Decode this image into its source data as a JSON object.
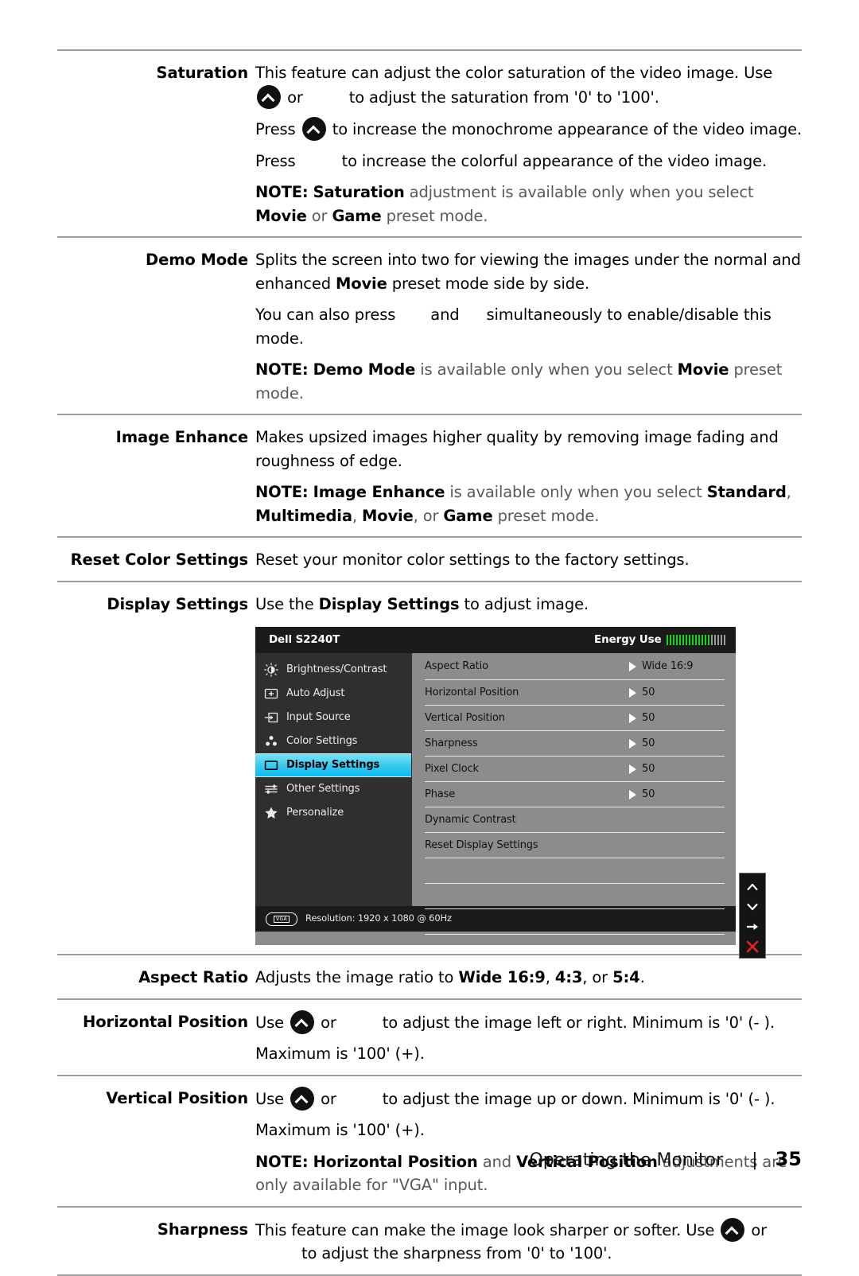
{
  "document": {
    "footer": {
      "section_title": "Operating the Monitor",
      "separator": "|",
      "page_number": "35"
    }
  },
  "rows": [
    {
      "label": "Saturation",
      "paragraphs": [
        "This feature can adjust the color saturation of the video image. Use",
        "or",
        "to adjust the saturation from '0' to '100'.",
        "Press",
        "to increase the monochrome appearance of the video image.",
        "Press",
        "to increase the colorful appearance of the video image."
      ],
      "note": {
        "prefix": "NOTE:",
        "term1": "Saturation",
        "mid1": " adjustment is available only when you select ",
        "term2": "Movie",
        "mid2": " or ",
        "term3": "Game",
        "suffix": " preset mode."
      }
    },
    {
      "label": "Demo Mode",
      "paragraphs": [
        "Splits the screen into two for viewing the images under the normal and enhanced",
        "Movie",
        "preset mode side by side.",
        "You can also press",
        "and",
        "simultaneously to enable/disable this mode."
      ],
      "note": {
        "prefix": "NOTE:",
        "term1": "Demo Mode",
        "mid1": " is available only when you select ",
        "term2": "Movie",
        "suffix": " preset mode."
      }
    },
    {
      "label": "Image Enhance",
      "paragraphs": [
        "Makes upsized images higher quality by removing image fading and roughness of edge."
      ],
      "note": {
        "prefix": "NOTE:",
        "term1": "Image Enhance",
        "mid1": " is available only when you select ",
        "term2": "Standard",
        "mid2": ", ",
        "term3": "Multimedia",
        "mid3": ", ",
        "term4": "Movie",
        "mid4": ", or ",
        "term5": "Game",
        "suffix": " preset mode."
      }
    },
    {
      "label": "Reset Color Settings",
      "paragraphs": [
        "Reset your monitor color settings to the factory settings."
      ]
    },
    {
      "label": "Display Settings",
      "paragraphs": [
        "Use the",
        "Display Settings",
        "to adjust image."
      ]
    },
    {
      "label": "Aspect Ratio",
      "paragraphs": [
        "Adjusts the image ratio to",
        "Wide 16:9",
        ",",
        "4:3",
        ", or",
        "5:4",
        "."
      ]
    },
    {
      "label": "Horizontal Position",
      "paragraphs": [
        "Use",
        "or",
        "to adjust the image left or right. Minimum is '0' (- ).",
        "Maximum is '100' (+)."
      ]
    },
    {
      "label": "Vertical Position",
      "paragraphs": [
        "Use",
        "or",
        "to adjust the image up or down. Minimum is '0' (- ).",
        "Maximum is '100' (+)."
      ],
      "note": {
        "prefix": "NOTE:",
        "term1": "Horizontal Position",
        "mid1": " and ",
        "term2": "Vertical Position",
        "suffix": " adjustments are only available for \"VGA\" input."
      }
    },
    {
      "label": "Sharpness",
      "paragraphs": [
        "This feature can make the image look sharper or softer. Use",
        "or",
        "to adjust the sharpness from '0' to '100'."
      ]
    }
  ],
  "osd": {
    "title": "Dell S2240T",
    "energy_label": "Energy Use",
    "energy_bars_total": 19,
    "energy_bars_green": 14,
    "menu": [
      {
        "label": "Brightness/Contrast",
        "icon": "brightness-icon",
        "selected": false
      },
      {
        "label": "Auto Adjust",
        "icon": "auto-adjust-icon",
        "selected": false
      },
      {
        "label": "Input Source",
        "icon": "input-source-icon",
        "selected": false
      },
      {
        "label": "Color Settings",
        "icon": "color-settings-icon",
        "selected": false
      },
      {
        "label": "Display Settings",
        "icon": "display-settings-icon",
        "selected": true
      },
      {
        "label": "Other Settings",
        "icon": "other-settings-icon",
        "selected": false
      },
      {
        "label": "Personalize",
        "icon": "star-icon",
        "selected": false
      }
    ],
    "options": [
      {
        "name": "Aspect Ratio",
        "value": "Wide 16:9",
        "arrow": true
      },
      {
        "name": "Horizontal Position",
        "value": "50",
        "arrow": true
      },
      {
        "name": "Vertical Position",
        "value": "50",
        "arrow": true
      },
      {
        "name": "Sharpness",
        "value": "50",
        "arrow": true
      },
      {
        "name": "Pixel Clock",
        "value": "50",
        "arrow": true
      },
      {
        "name": "Phase",
        "value": "50",
        "arrow": true
      },
      {
        "name": "Dynamic Contrast",
        "value": "",
        "arrow": false
      },
      {
        "name": "Reset Display Settings",
        "value": "",
        "arrow": false
      },
      {
        "name": "",
        "value": "",
        "arrow": false
      },
      {
        "name": "",
        "value": "",
        "arrow": false
      },
      {
        "name": "",
        "value": "",
        "arrow": false
      }
    ],
    "status": {
      "connector": "VGA",
      "resolution": "Resolution: 1920 x 1080 @ 60Hz"
    },
    "nav_icons": [
      "chevron-up-icon",
      "chevron-down-icon",
      "arrow-right-icon",
      "close-x-icon"
    ],
    "colors": {
      "highlight": "#0cbcf0",
      "panel": "#8c8c8c",
      "sidebar": "#2f2f2f",
      "titlebar": "#1b1b1b",
      "energy_green": "#19d119",
      "close_red": "#e8221f"
    }
  }
}
